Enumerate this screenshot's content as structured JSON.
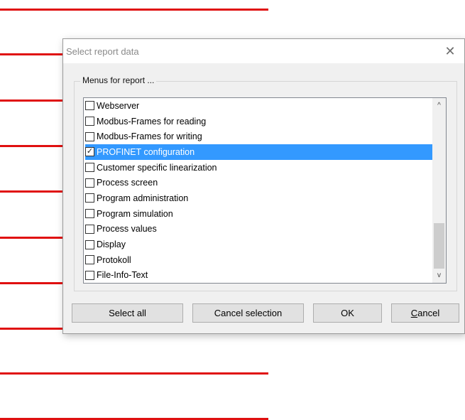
{
  "dialog": {
    "title": "Select report data",
    "close_glyph": "✕",
    "group_label": "Menus for report ...",
    "items": [
      {
        "label": "Webserver",
        "checked": false,
        "selected": false
      },
      {
        "label": "Modbus-Frames for reading",
        "checked": false,
        "selected": false
      },
      {
        "label": "Modbus-Frames for writing",
        "checked": false,
        "selected": false
      },
      {
        "label": "PROFINET configuration",
        "checked": true,
        "selected": true
      },
      {
        "label": "Customer specific linearization",
        "checked": false,
        "selected": false
      },
      {
        "label": "Process screen",
        "checked": false,
        "selected": false
      },
      {
        "label": "Program administration",
        "checked": false,
        "selected": false
      },
      {
        "label": "Program simulation",
        "checked": false,
        "selected": false
      },
      {
        "label": "Process values",
        "checked": false,
        "selected": false
      },
      {
        "label": "Display",
        "checked": false,
        "selected": false
      },
      {
        "label": "Protokoll",
        "checked": false,
        "selected": false
      },
      {
        "label": "File-Info-Text",
        "checked": false,
        "selected": false
      }
    ],
    "scroll_up_glyph": "^",
    "scroll_down_glyph": "v",
    "buttons": {
      "select_all": "Select all",
      "cancel_selection": "Cancel selection",
      "ok": "OK",
      "cancel_first": "C",
      "cancel_rest": "ancel"
    }
  },
  "colors": {
    "accent_line": "#e01010",
    "selection": "#3399ff"
  }
}
